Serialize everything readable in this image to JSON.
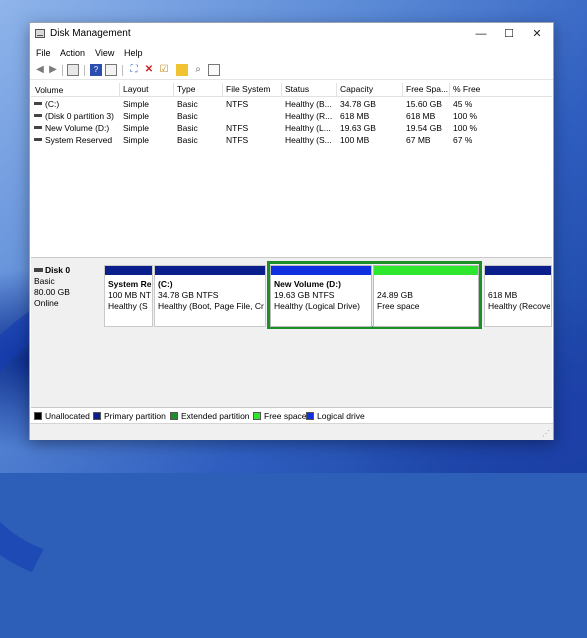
{
  "window": {
    "title": "Disk Management",
    "minimize": "—",
    "maximize": "☐",
    "close": "✕"
  },
  "menu": [
    "File",
    "Action",
    "View",
    "Help"
  ],
  "volume_table": {
    "headers": [
      "Volume",
      "Layout",
      "Type",
      "File System",
      "Status",
      "Capacity",
      "Free Spa...",
      "% Free"
    ],
    "rows": [
      [
        "(C:)",
        "Simple",
        "Basic",
        "NTFS",
        "Healthy (B...",
        "34.78 GB",
        "15.60 GB",
        "45 %"
      ],
      [
        "(Disk 0 partition 3)",
        "Simple",
        "Basic",
        "",
        "Healthy (R...",
        "618 MB",
        "618 MB",
        "100 %"
      ],
      [
        "New Volume (D:)",
        "Simple",
        "Basic",
        "NTFS",
        "Healthy (L...",
        "19.63 GB",
        "19.54 GB",
        "100 %"
      ],
      [
        "System Reserved",
        "Simple",
        "Basic",
        "NTFS",
        "Healthy (S...",
        "100 MB",
        "67 MB",
        "67 %"
      ]
    ]
  },
  "disk": {
    "name": "Disk 0",
    "type": "Basic",
    "size": "80.00 GB",
    "state": "Online",
    "partitions": [
      {
        "name": "System Re",
        "size": "100 MB NT",
        "status": "Healthy (S",
        "color": "#0a1f8c"
      },
      {
        "name": "(C:)",
        "size": "34.78 GB NTFS",
        "status": "Healthy (Boot, Page File, Cr",
        "color": "#0a1f8c"
      },
      {
        "name": "New Volume  (D:)",
        "size": "19.63 GB NTFS",
        "status": "Healthy (Logical Drive)",
        "color": "#1030e0"
      },
      {
        "name": "",
        "size": "24.89 GB",
        "status": "Free space",
        "color": "#2ee62e"
      },
      {
        "name": "",
        "size": "618 MB",
        "status": "Healthy (Recove",
        "color": "#0a1f8c"
      }
    ]
  },
  "legend": [
    {
      "label": "Unallocated",
      "color": "#000000"
    },
    {
      "label": "Primary partition",
      "color": "#0a1f8c"
    },
    {
      "label": "Extended partition",
      "color": "#1d8f2a"
    },
    {
      "label": "Free space",
      "color": "#2ee62e"
    },
    {
      "label": "Logical drive",
      "color": "#1030e0"
    }
  ],
  "annotation_arrow_color": "#e0201c"
}
